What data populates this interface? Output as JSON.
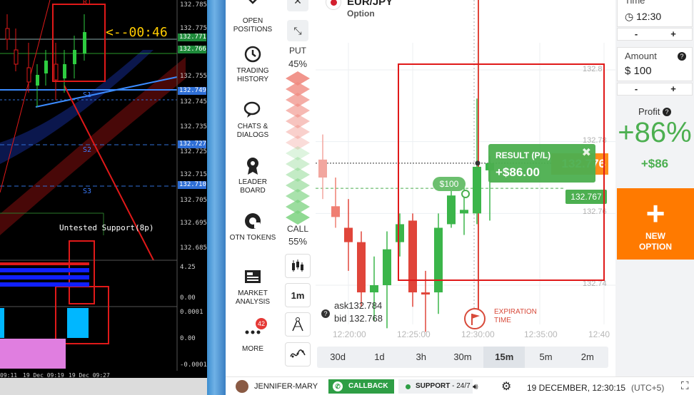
{
  "mt4": {
    "price_ticks": [
      "132.785",
      "132.775",
      "132.765",
      "132.755",
      "132.745",
      "132.735",
      "132.725",
      "132.715",
      "132.705",
      "132.695",
      "132.685"
    ],
    "price_tags": [
      {
        "label": "132.771",
        "color": "#1e8a3a"
      },
      {
        "label": "132.766",
        "color": "#1e8a3a"
      },
      {
        "label": "132.749",
        "color": "#2f6fd6"
      },
      {
        "label": "132.727",
        "color": "#2f6fd6"
      },
      {
        "label": "132.710",
        "color": "#2f6fd6"
      }
    ],
    "levels": [
      "R1",
      "S1",
      "S2",
      "S3"
    ],
    "timer": "<--00:46",
    "support_note": "Untested Support(8p)",
    "indicator_ticks": [
      "4.25",
      "0.00",
      "0.0001",
      "0.00",
      "-0.0001"
    ],
    "times": [
      "09:11",
      "19 Dec 09:19",
      "19 Dec 09:27"
    ]
  },
  "nav": {
    "items": [
      {
        "label": "OPEN POSITIONS",
        "icon": "open-positions-icon"
      },
      {
        "label": "TRADING HISTORY",
        "icon": "history-icon"
      },
      {
        "label": "CHATS & DIALOGS",
        "icon": "chat-icon"
      },
      {
        "label": "LEADER BOARD",
        "icon": "leader-icon"
      },
      {
        "label": "OTN TOKENS",
        "icon": "otn-icon"
      },
      {
        "label": "MARKET ANALYSIS",
        "icon": "analysis-icon"
      },
      {
        "label": "MORE",
        "icon": "more-icon"
      }
    ],
    "more_badge": "42"
  },
  "tools": {
    "close_glyph": "✕",
    "collapse_glyph": "⤡",
    "put_label": "PUT",
    "put_pct": "45%",
    "call_label": "CALL",
    "call_pct": "55%",
    "timeframe": "1m"
  },
  "chart": {
    "asset_name": "EUR/JPY",
    "asset_type": "Option",
    "price_ticks": [
      "132.8",
      "132.78",
      "132.76",
      "132.76",
      "132.74"
    ],
    "result_title": "RESULT (P/L)",
    "result_value": "+$86.00",
    "result_close": "✖",
    "live_price": "132.776",
    "current_price": "132.767",
    "deal_amount": "$100",
    "ask": "ask132.784",
    "bid": "bid 132.768",
    "expiry_label": "EXPIRATION TIME",
    "time_ticks": [
      "12:20:00",
      "12:25:00",
      "12:30:00",
      "12:35:00",
      "12:40"
    ],
    "timeframes": [
      "30d",
      "1d",
      "3h",
      "30m",
      "15m",
      "5m",
      "2m"
    ],
    "active_timeframe": "15m"
  },
  "chart_data": {
    "type": "candlestick",
    "candles": [
      {
        "o": 132.77,
        "h": 132.782,
        "l": 132.764,
        "c": 132.775,
        "dir": "down"
      },
      {
        "o": 132.762,
        "h": 132.77,
        "l": 132.756,
        "c": 132.759,
        "dir": "down"
      },
      {
        "o": 132.756,
        "h": 132.764,
        "l": 132.744,
        "c": 132.752,
        "dir": "down"
      },
      {
        "o": 132.752,
        "h": 132.755,
        "l": 132.734,
        "c": 132.738,
        "dir": "down"
      },
      {
        "o": 132.74,
        "h": 132.748,
        "l": 132.73,
        "c": 132.738,
        "dir": "up"
      },
      {
        "o": 132.74,
        "h": 132.755,
        "l": 132.728,
        "c": 132.75,
        "dir": "up"
      },
      {
        "o": 132.752,
        "h": 132.76,
        "l": 132.748,
        "c": 132.757,
        "dir": "up"
      },
      {
        "o": 132.758,
        "h": 132.76,
        "l": 132.734,
        "c": 132.738,
        "dir": "down"
      },
      {
        "o": 132.738,
        "h": 132.744,
        "l": 132.727,
        "c": 132.738,
        "dir": "down"
      },
      {
        "o": 132.738,
        "h": 132.76,
        "l": 132.732,
        "c": 132.756,
        "dir": "up"
      },
      {
        "o": 132.757,
        "h": 132.769,
        "l": 132.756,
        "c": 132.765,
        "dir": "up"
      },
      {
        "o": 132.761,
        "h": 132.768,
        "l": 132.754,
        "c": 132.76,
        "dir": "up"
      },
      {
        "o": 132.76,
        "h": 132.792,
        "l": 132.757,
        "c": 132.773,
        "dir": "up"
      },
      {
        "o": 132.772,
        "h": 132.776,
        "l": 132.758,
        "c": 132.774,
        "dir": "up"
      }
    ],
    "current_price": 132.767,
    "strike_price": 132.774
  },
  "right": {
    "time_label": "Time",
    "time_value": "12:30",
    "amount_label": "Amount",
    "amount_currency": "$",
    "amount_value": "100",
    "minus": "-",
    "plus": "+",
    "profit_label": "Profit",
    "profit_pct": "+86%",
    "profit_amount": "+$86",
    "new_option_plus": "+",
    "new_option_label": "NEW OPTION"
  },
  "bottom": {
    "username": "JENNIFER-MARY",
    "callback": "CALLBACK",
    "support": "SUPPORT",
    "support_hours": " - 24/7",
    "datetime": "19 DECEMBER, 12:30:15",
    "timezone": "(UTC+5)"
  }
}
